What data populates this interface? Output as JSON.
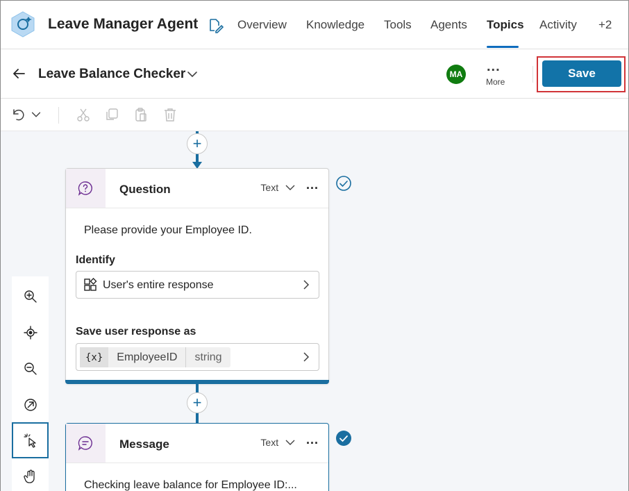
{
  "header": {
    "agent_icon": "copilot-agent-icon",
    "agent_name": "Leave Manager Agent",
    "edit_icon": "edit-agent-icon",
    "tabs": [
      {
        "label": "Overview",
        "active": false
      },
      {
        "label": "Knowledge",
        "active": false
      },
      {
        "label": "Tools",
        "active": false
      },
      {
        "label": "Agents",
        "active": false
      },
      {
        "label": "Topics",
        "active": true
      },
      {
        "label": "Activity",
        "active": false
      },
      {
        "label": "+2",
        "active": false
      }
    ],
    "accent_color": "#1a6ea0"
  },
  "topic_bar": {
    "back_icon": "back-arrow-icon",
    "topic_name": "Leave Balance Checker",
    "avatar_initials": "MA",
    "avatar_color": "#107c10",
    "more_dots": "...",
    "more_label": "More",
    "save_label": "Save",
    "save_highlight_color": "#d13438"
  },
  "toolbar": {
    "icons": [
      "undo-icon",
      "chevron-down-icon",
      "cut-icon",
      "copy-icon",
      "paste-icon",
      "delete-icon"
    ]
  },
  "canvas": {
    "question_node": {
      "title": "Question",
      "type_label": "Text",
      "menu": "...",
      "prompt": "Please provide your Employee ID.",
      "identify_label": "Identify",
      "identify_value": "User's entire response",
      "save_label": "Save user response as",
      "var_symbol": "{x}",
      "var_name": "EmployeeID",
      "var_type": "string",
      "status": "validated"
    },
    "message_node": {
      "title": "Message",
      "type_label": "Text",
      "menu": "...",
      "text": "Checking leave balance for Employee ID:...",
      "status": "validated-filled"
    },
    "add_node_symbol": "+"
  },
  "zoom_panel": {
    "icons": [
      "zoom-in-icon",
      "recenter-icon",
      "zoom-out-icon",
      "minimap-icon",
      "select-cursor-icon",
      "pan-hand-icon"
    ],
    "selected": "select-cursor-icon"
  }
}
